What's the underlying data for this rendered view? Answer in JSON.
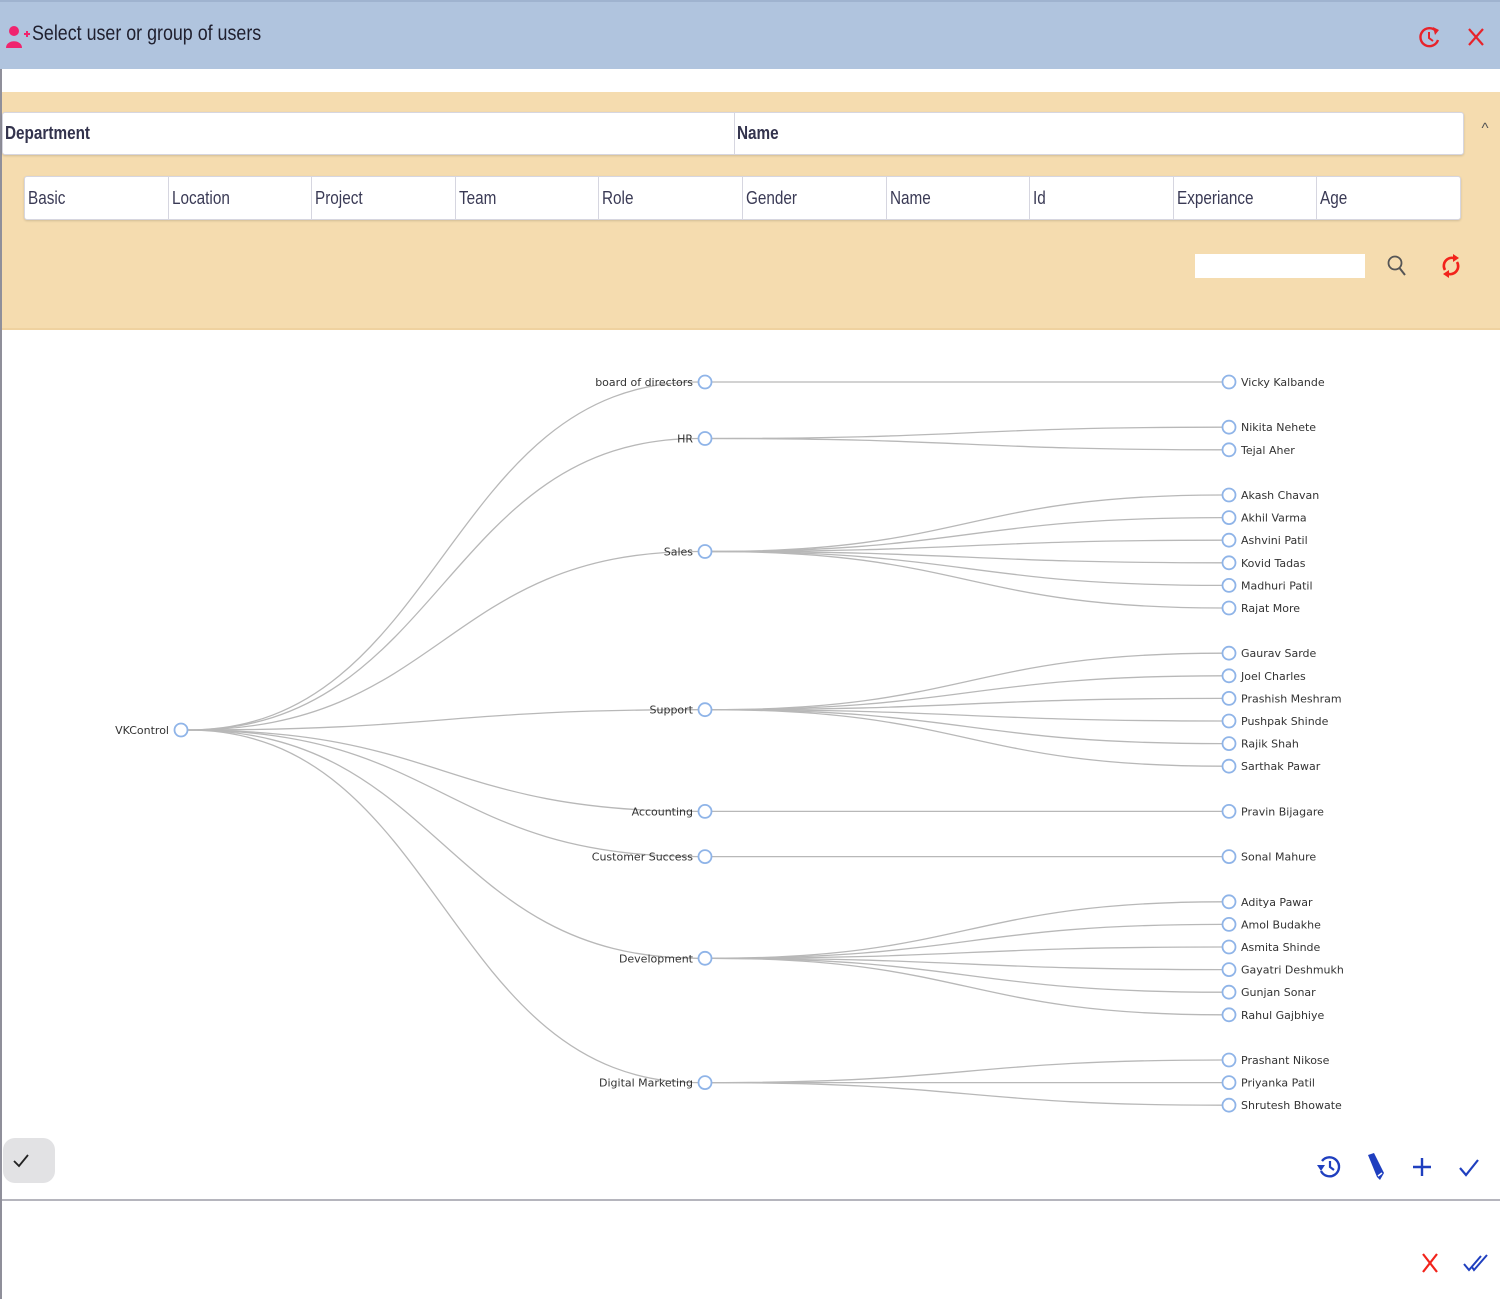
{
  "window": {
    "title": "Select user or group of users",
    "title_icon": "user-plus-icon",
    "actions": [
      {
        "name": "history-icon",
        "color": "#e8232a"
      },
      {
        "name": "close-icon",
        "color": "#e8232a"
      }
    ]
  },
  "filter": {
    "top_columns": [
      "Department",
      "Name"
    ],
    "collapse_label": "^",
    "tabs": [
      "Basic",
      "Location",
      "Project",
      "Team",
      "Role",
      "Gender",
      "Name",
      "Id",
      "Experiance",
      "Age"
    ],
    "search": {
      "value": "",
      "placeholder": ""
    },
    "search_icon": "search-icon",
    "refresh_icon": "refresh-icon"
  },
  "tree": {
    "root": "VKControl",
    "departments": [
      {
        "name": "board of directors",
        "members": [
          "Vicky Kalbande"
        ]
      },
      {
        "name": "HR",
        "members": [
          "Nikita Nehete",
          "Tejal Aher"
        ]
      },
      {
        "name": "Sales",
        "members": [
          "Akash Chavan",
          "Akhil Varma",
          "Ashvini Patil",
          "Kovid Tadas",
          "Madhuri Patil",
          "Rajat More"
        ]
      },
      {
        "name": "Support",
        "members": [
          "Gaurav Sarde",
          "Joel Charles",
          "Prashish Meshram",
          "Pushpak Shinde",
          "Rajik Shah",
          "Sarthak Pawar"
        ]
      },
      {
        "name": "Accounting",
        "members": [
          "Pravin Bijagare"
        ]
      },
      {
        "name": "Customer Success",
        "members": [
          "Sonal Mahure"
        ]
      },
      {
        "name": "Development",
        "members": [
          "Aditya Pawar",
          "Amol Budakhe",
          "Asmita Shinde",
          "Gayatri Deshmukh",
          "Gunjan Sonar",
          "Rahul Gajbhiye"
        ]
      },
      {
        "name": "Digital Marketing",
        "members": [
          "Prashant Nikose",
          "Priyanka Patil",
          "Shrutesh Bhowate"
        ]
      }
    ]
  },
  "toolbar": {
    "ok_chip_icon": "check-icon",
    "actions": [
      "history-icon",
      "pen-icon",
      "add-icon",
      "check-icon"
    ]
  },
  "footer": {
    "actions": [
      "cancel-icon",
      "confirm-all-icon"
    ]
  },
  "colors": {
    "title_bar": "#b0c4de",
    "filter_panel": "#f5dcaf",
    "accent_red": "#e8232a",
    "accent_blue": "#1f3fbf",
    "node_stroke": "#8fb4e8",
    "link": "#b8b8b8"
  }
}
